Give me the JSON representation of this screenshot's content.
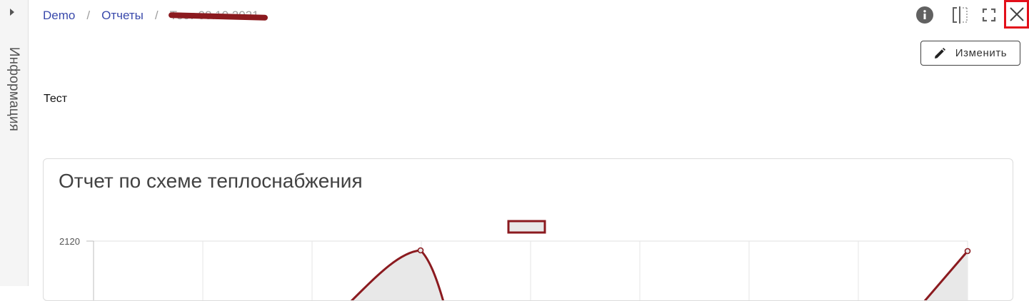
{
  "side_panel": {
    "label": "Информация",
    "toggle_icon": "caret-right-icon"
  },
  "breadcrumb": {
    "items": [
      "Demo",
      "Отчеты"
    ],
    "current": "Тест 08.10.2021"
  },
  "toolbar": {
    "icons": [
      "info-icon",
      "split-view-icon",
      "fullscreen-icon",
      "close-icon"
    ]
  },
  "actions": {
    "edit_label": "Изменить"
  },
  "description": "Тест",
  "report": {
    "title": "Отчет по схеме теплоснабжения"
  },
  "colors": {
    "accent": "#3949ab",
    "series": "#8b1a1f",
    "series_fill": "#e8e8e8",
    "close_highlight": "#e3101b"
  },
  "chart_data": {
    "type": "area",
    "y_ticks": [
      2120
    ],
    "series": [
      {
        "color": "#8b1a1f",
        "points": [
          {
            "x": 3,
            "y": 2100
          },
          {
            "x": 8,
            "y": 2100
          }
        ]
      }
    ],
    "legend": "top-center",
    "grid": true
  }
}
